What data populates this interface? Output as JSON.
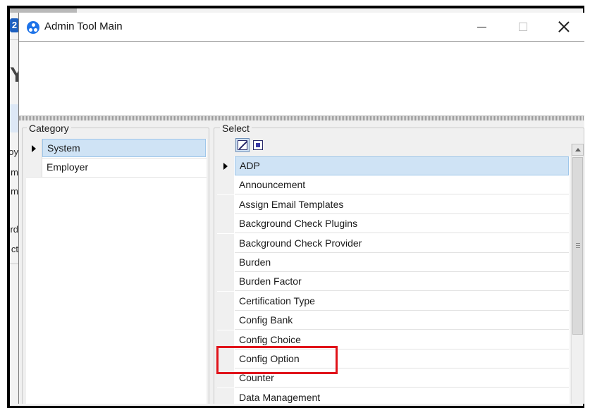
{
  "window": {
    "title": "Admin Tool Main",
    "controls": {
      "minimize": "—",
      "maximize": "☐",
      "close": "✕"
    }
  },
  "background_app": {
    "logo_glyph": "2",
    "big_char": "Y",
    "side_labels": [
      "oy",
      "m",
      "m",
      "rd",
      "ct"
    ]
  },
  "category": {
    "legend": "Category",
    "rows": [
      {
        "label": "System",
        "selected": true
      },
      {
        "label": "Employer",
        "selected": false
      }
    ]
  },
  "select": {
    "legend": "Select",
    "toolbar": {
      "check_all_icon": "checkbox-cross-icon",
      "select_all_icon": "filled-square-icon"
    },
    "rows": [
      {
        "label": "ADP",
        "selected": true
      },
      {
        "label": "Announcement",
        "selected": false
      },
      {
        "label": "Assign Email Templates",
        "selected": false
      },
      {
        "label": "Background Check Plugins",
        "selected": false
      },
      {
        "label": "Background Check Provider",
        "selected": false
      },
      {
        "label": "Burden",
        "selected": false
      },
      {
        "label": "Burden Factor",
        "selected": false
      },
      {
        "label": "Certification Type",
        "selected": false
      },
      {
        "label": "Config Bank",
        "selected": false
      },
      {
        "label": "Config Choice",
        "selected": false
      },
      {
        "label": "Config Option",
        "selected": false
      },
      {
        "label": "Counter",
        "selected": false
      },
      {
        "label": "Data Management",
        "selected": false
      }
    ]
  },
  "colors": {
    "selection": "#cfe3f5",
    "highlight": "#e0131a",
    "app_icon": "#1e73e8"
  }
}
